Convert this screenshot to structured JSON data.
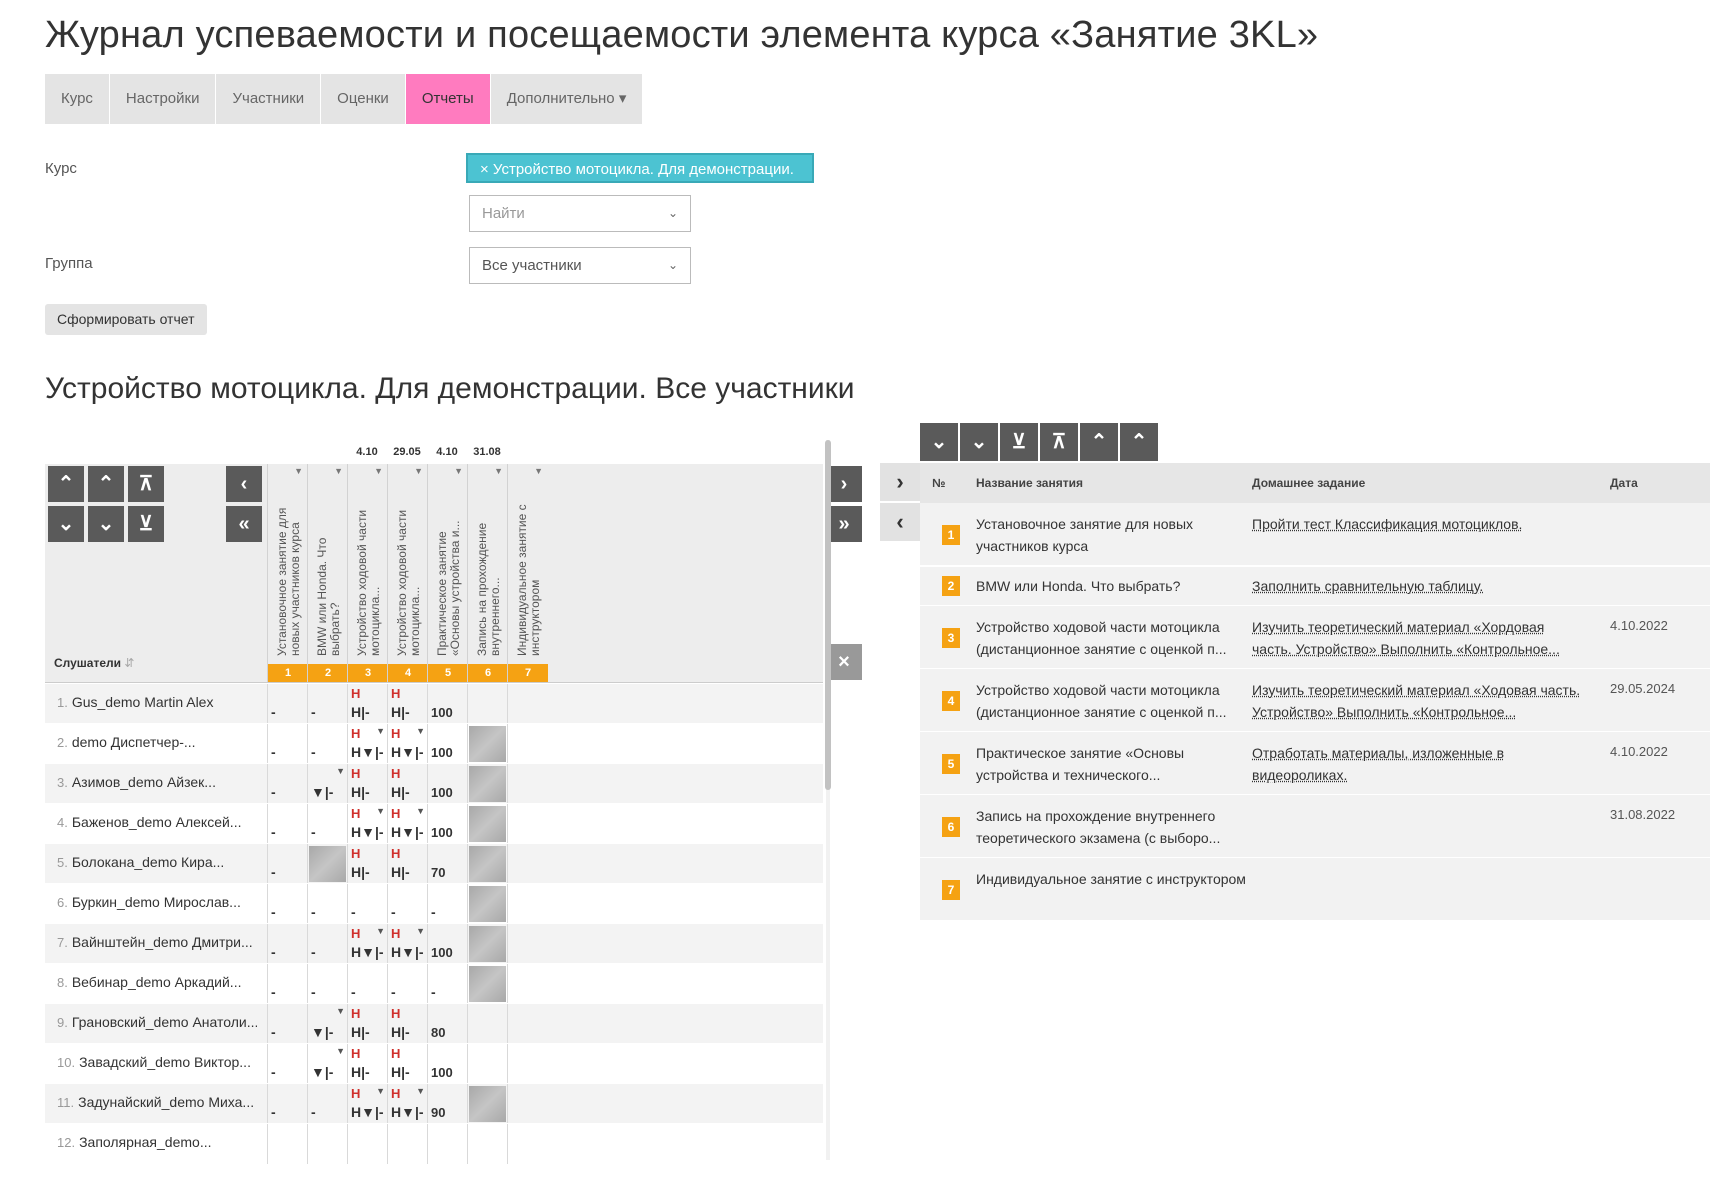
{
  "page": {
    "title": "Журнал успеваемости и посещаемости элемента курса «Занятие 3KL»"
  },
  "tabs": [
    {
      "label": "Курс",
      "active": false
    },
    {
      "label": "Настройки",
      "active": false
    },
    {
      "label": "Участники",
      "active": false
    },
    {
      "label": "Оценки",
      "active": false
    },
    {
      "label": "Отчеты",
      "active": true
    },
    {
      "label": "Дополнительно ▾",
      "active": false
    }
  ],
  "form": {
    "course_label": "Курс",
    "course_chip": "× Устройство мотоцикла. Для демонстрации.",
    "search_placeholder": "Найти",
    "group_label": "Группа",
    "group_value": "Все участники",
    "submit": "Сформировать отчет"
  },
  "section_title": "Устройство мотоцикла. Для демонстрации. Все участники",
  "journal": {
    "listeners_label": "Слушатели",
    "sort_icon": "sort-name-icon",
    "columns": [
      {
        "num": "1",
        "title": "Установочное занятие для новых участников курса",
        "date": ""
      },
      {
        "num": "2",
        "title": "BMW или Honda. Что выбрать?",
        "date": ""
      },
      {
        "num": "3",
        "title": "Устройство ходовой части мотоцикла...",
        "date": "4.10"
      },
      {
        "num": "4",
        "title": "Устройство ходовой части мотоцикла...",
        "date": "29.05"
      },
      {
        "num": "5",
        "title": "Практическое занятие «Основы устройства и...",
        "date": "4.10"
      },
      {
        "num": "6",
        "title": "Запись на прохождение внутреннего...",
        "date": "31.08"
      },
      {
        "num": "7",
        "title": "Индивидуальное занятие с инструктором",
        "date": ""
      }
    ],
    "rows": [
      {
        "idx": "1.",
        "name": "Gus_demo Martin Alex",
        "cells": [
          "-",
          "-",
          "Н|-",
          "Н|-",
          "100",
          "",
          ""
        ]
      },
      {
        "idx": "2.",
        "name": "demo Диспетчер-...",
        "cells": [
          "-",
          "-",
          "Н▼|-",
          "Н▼|-",
          "100",
          "#",
          ""
        ]
      },
      {
        "idx": "3.",
        "name": "Азимов_demo Айзек...",
        "cells": [
          "-",
          "▼|-",
          "Н|-",
          "Н|-",
          "100",
          "#",
          ""
        ]
      },
      {
        "idx": "4.",
        "name": "Баженов_demo Алексей...",
        "cells": [
          "-",
          "-",
          "Н▼|-",
          "Н▼|-",
          "100",
          "#",
          ""
        ]
      },
      {
        "idx": "5.",
        "name": "Болокана_demo Кира...",
        "cells": [
          "-",
          "#",
          "Н|-",
          "Н|-",
          "70",
          "#",
          ""
        ]
      },
      {
        "idx": "6.",
        "name": "Буркин_demo Мирослав...",
        "cells": [
          "-",
          "-",
          "-",
          "-",
          "-",
          "#",
          ""
        ]
      },
      {
        "idx": "7.",
        "name": "Вайнштейн_demo Дмитри...",
        "cells": [
          "-",
          "-",
          "Н▼|-",
          "Н▼|-",
          "100",
          "#",
          ""
        ]
      },
      {
        "idx": "8.",
        "name": "Вебинар_demo Аркадий...",
        "cells": [
          "-",
          "-",
          "-",
          "-",
          "-",
          "#",
          ""
        ]
      },
      {
        "idx": "9.",
        "name": "Грановский_demo Анатоли...",
        "cells": [
          "-",
          "▼|-",
          "Н|-",
          "Н|-",
          "80",
          "",
          ""
        ]
      },
      {
        "idx": "10.",
        "name": "Завадский_demo Виктор...",
        "cells": [
          "-",
          "▼|-",
          "Н|-",
          "Н|-",
          "100",
          "",
          ""
        ]
      },
      {
        "idx": "11.",
        "name": "Задунайский_demo Миха...",
        "cells": [
          "-",
          "-",
          "Н▼|-",
          "Н▼|-",
          "90",
          "#",
          ""
        ]
      },
      {
        "idx": "12.",
        "name": "Заполярная_demo...",
        "cells": [
          "",
          "",
          "",
          "",
          "",
          "",
          ""
        ]
      }
    ]
  },
  "lessons": {
    "headers": {
      "num": "№",
      "name": "Название занятия",
      "homework": "Домашнее задание",
      "date": "Дата"
    },
    "rows": [
      {
        "num": "1",
        "name": "Установочное занятие для новых участников курса",
        "homework": "Пройти тест Классификация мотоциклов.",
        "date": ""
      },
      {
        "num": "2",
        "name": "BMW или Honda. Что выбрать?",
        "homework": "Заполнить сравнительную таблицу.",
        "date": ""
      },
      {
        "num": "3",
        "name": "Устройство ходовой части мотоцикла (дистанционное занятие с оценкой п...",
        "homework": "Изучить теоретический материал «Хордовая часть. Устройство» Выполнить «Контрольное...",
        "date": "4.10.2022"
      },
      {
        "num": "4",
        "name": "Устройство ходовой части мотоцикла (дистанционное занятие с оценкой п...",
        "homework": "Изучить теоретический материал «Ходовая часть. Устройство» Выполнить «Контрольное...",
        "date": "29.05.2024"
      },
      {
        "num": "5",
        "name": "Практическое занятие «Основы устройства и технического...",
        "homework": "Отработать материалы, изложенные в видеороликах.",
        "date": "4.10.2022"
      },
      {
        "num": "6",
        "name": "Запись на прохождение внутреннего теоретического экзамена (с выборо...",
        "homework": "",
        "date": "31.08.2022"
      },
      {
        "num": "7",
        "name": "Индивидуальное занятие с инструктором",
        "homework": "",
        "date": ""
      }
    ]
  },
  "colors": {
    "accent_pink": "#ff7bbf",
    "chip": "#4cc3d2",
    "orange": "#f5a213",
    "absent_red": "#d0302c"
  }
}
